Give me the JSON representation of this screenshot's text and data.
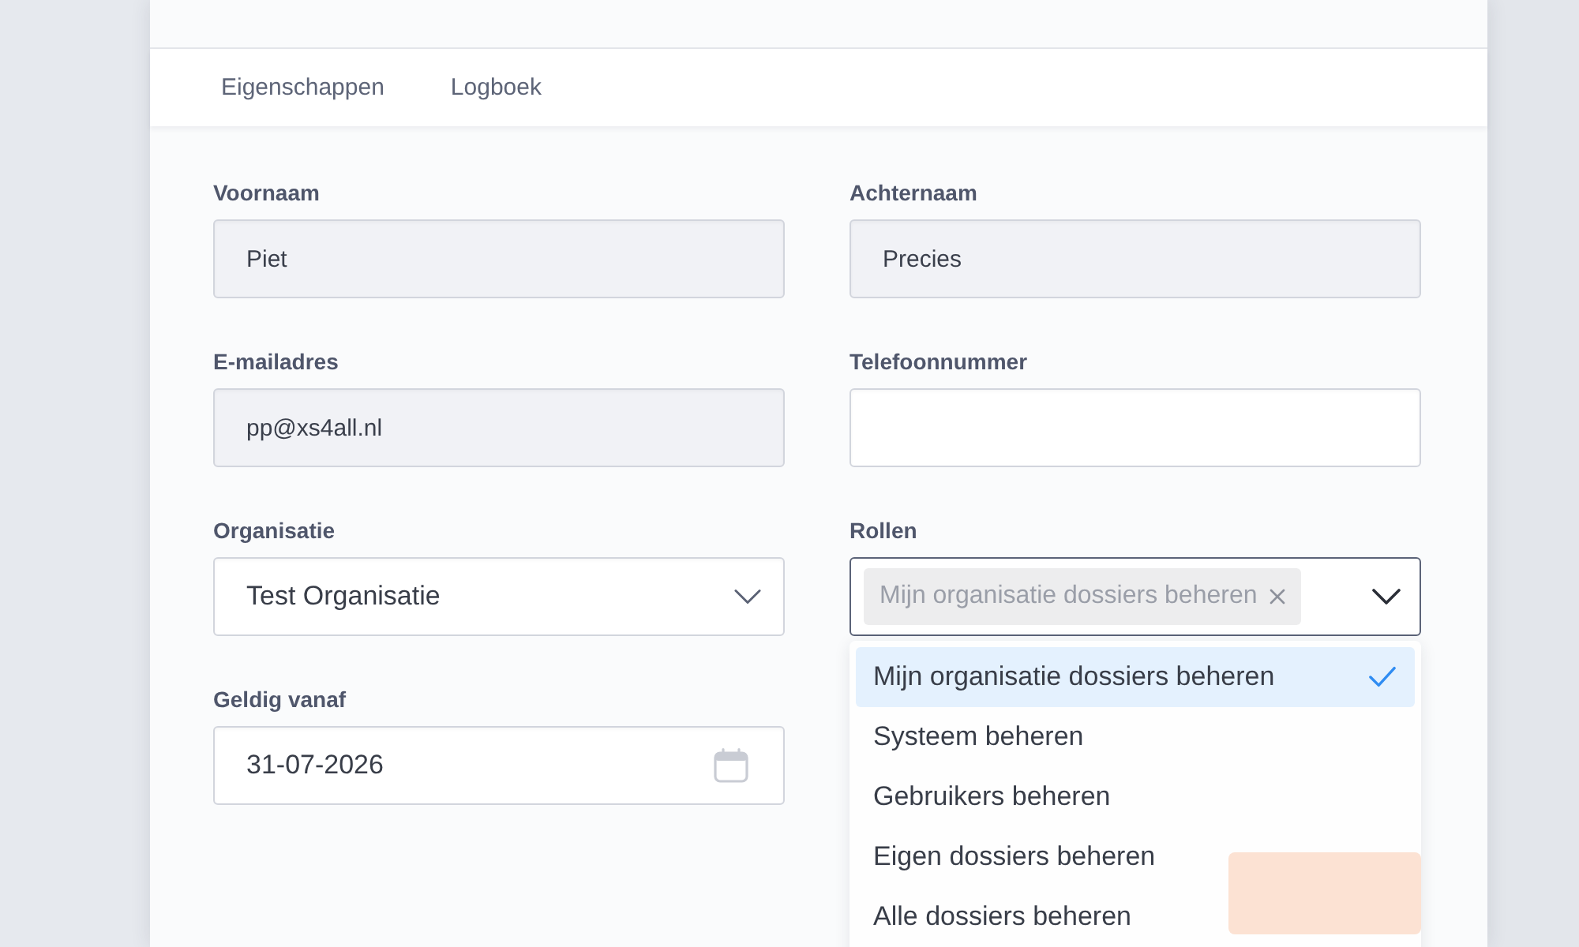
{
  "tabs": [
    {
      "label": "Eigenschappen"
    },
    {
      "label": "Logboek"
    }
  ],
  "fields": [
    {
      "label": "Voornaam",
      "kind": "text",
      "value": "Piet",
      "disabled": true
    },
    {
      "label": "Achternaam",
      "kind": "text",
      "value": "Precies",
      "disabled": true
    },
    {
      "label": "E-mailadres",
      "kind": "text",
      "value": "pp@xs4all.nl",
      "disabled": true
    },
    {
      "label": "Telefoonnummer",
      "kind": "text",
      "disabled": false
    },
    {
      "label": "Organisatie",
      "kind": "select",
      "value": "Test Organisatie"
    },
    {
      "label": "Rollen",
      "kind": "multiselect",
      "tags": [
        "Mijn organisatie dossiers beheren"
      ],
      "expanded": true
    },
    {
      "label": "Geldig vanaf",
      "kind": "date",
      "value": "31-07-2026"
    }
  ],
  "roles_dropdown": {
    "options": [
      {
        "label": "Mijn organisatie dossiers beheren",
        "selected": true
      },
      {
        "label": "Systeem beheren",
        "selected": false
      },
      {
        "label": "Gebruikers beheren",
        "selected": false
      },
      {
        "label": "Eigen dossiers beheren",
        "selected": false
      },
      {
        "label": "Alle dossiers beheren",
        "selected": false
      }
    ]
  }
}
